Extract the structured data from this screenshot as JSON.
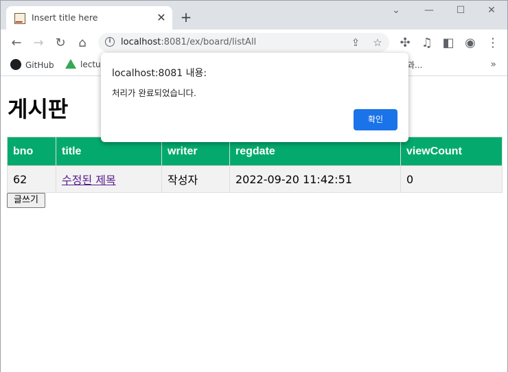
{
  "browser": {
    "tab_title": "Insert title here",
    "tab_close": "✕",
    "new_tab": "+",
    "window_controls": [
      "⌄",
      "—",
      "☐",
      "✕"
    ],
    "url_host": "localhost",
    "url_path": ":8081/ex/board/listAll",
    "bookmarks": [
      {
        "label": "GitHub",
        "icon": "github-icon"
      },
      {
        "label": "lectu",
        "icon": "google-drive-icon"
      }
    ],
    "bookmark_fragment": "과...",
    "bookmark_overflow": "»"
  },
  "page": {
    "title": "게시판",
    "columns": [
      "bno",
      "title",
      "writer",
      "regdate",
      "viewCount"
    ],
    "rows": [
      {
        "bno": "62",
        "title": "수정된 제목",
        "writer": "작성자",
        "regdate": "2022-09-20 11:42:51",
        "viewCount": "0"
      }
    ],
    "write_button": "글쓰기"
  },
  "dialog": {
    "title": "localhost:8081 내용:",
    "message": "처리가 완료되었습니다.",
    "ok_button": "확인"
  },
  "colors": {
    "header_green": "#04aa6d",
    "dialog_button_blue": "#1a73e8"
  }
}
